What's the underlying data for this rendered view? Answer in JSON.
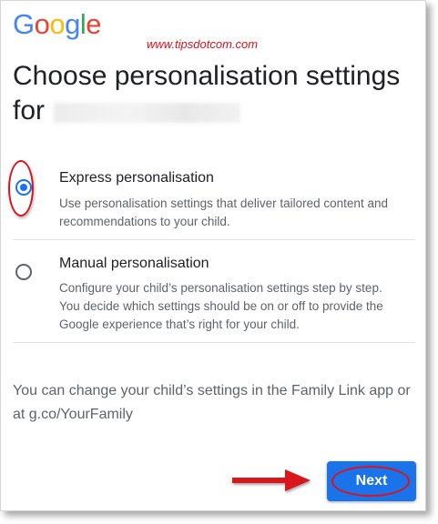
{
  "logo": {
    "letters": [
      "G",
      "o",
      "o",
      "g",
      "l",
      "e"
    ],
    "colors": [
      "#4285F4",
      "#EA4335",
      "#FBBC05",
      "#4285F4",
      "#34A853",
      "#EA4335"
    ]
  },
  "watermark": "www.tipsdotcom.com",
  "title": {
    "line1": "Choose personalisation settings",
    "line2_prefix": "for"
  },
  "options": [
    {
      "label": "Express personalisation",
      "description": "Use personalisation settings that deliver tailored content and recommendations to your child.",
      "selected": true
    },
    {
      "label": "Manual personalisation",
      "description": "Configure your child’s personalisation settings step by step. You decide which settings should be on or off to provide the Google experience that’s right for your child.",
      "selected": false
    }
  ],
  "note": "You can change your child’s settings in the Family Link app or at g.co/YourFamily",
  "next_button": {
    "label": "Next"
  },
  "colors": {
    "accent": "#1a73e8",
    "annotation": "#d8141c"
  }
}
